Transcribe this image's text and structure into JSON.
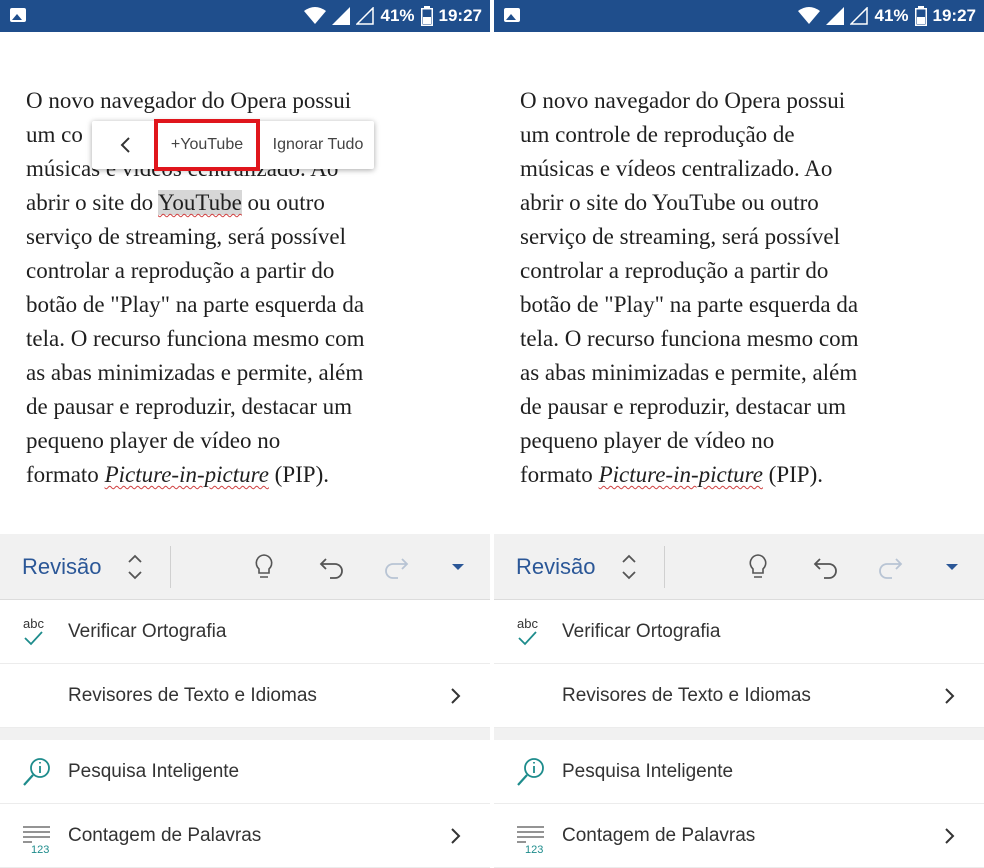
{
  "status_bar": {
    "battery": "41%",
    "time": "19:27"
  },
  "document": {
    "lines_left": [
      "O novo navegador do Opera possui",
      "um co",
      "músicas e vídeos centralizado. Ao",
      "abrir o site do ",
      "serviço de streaming, será possível",
      "controlar a reprodução a partir do",
      "botão de \"Play\" na parte esquerda da",
      "tela. O recurso funciona mesmo com",
      "as abas minimizadas e permite, além",
      "de pausar e reproduzir, destacar um",
      "pequeno player de vídeo no",
      "formato "
    ],
    "lines_right": [
      "O novo navegador do Opera possui",
      "um controle de reprodução de",
      "músicas e vídeos centralizado. Ao",
      "abrir o site do YouTube ou outro",
      "serviço de streaming, será possível",
      "controlar a reprodução a partir do",
      "botão de \"Play\" na parte esquerda da",
      "tela. O recurso funciona mesmo com",
      "as abas minimizadas e permite, além",
      "de pausar e reproduzir, destacar um",
      "pequeno player de vídeo no",
      "formato "
    ],
    "highlight_word": "YouTube",
    "after_highlight": " ou outro",
    "pip_italic": "Picture-in-picture",
    "pip_suffix": " (PIP)."
  },
  "spell_popup": {
    "add_label": "+YouTube",
    "ignore_label": "Ignorar Tudo"
  },
  "toolbar": {
    "tab_label": "Revisão"
  },
  "menu": {
    "spell_check": "Verificar Ortografia",
    "proofing": "Revisores de Texto e Idiomas",
    "smart_lookup": "Pesquisa Inteligente",
    "word_count": "Contagem de Palavras",
    "abc_text": "abc",
    "count_text": "123"
  },
  "colors": {
    "status_bar": "#1f4e8c",
    "accent": "#2b5797",
    "icon_teal": "#1e8c8c",
    "highlight_box": "#e0161c"
  }
}
